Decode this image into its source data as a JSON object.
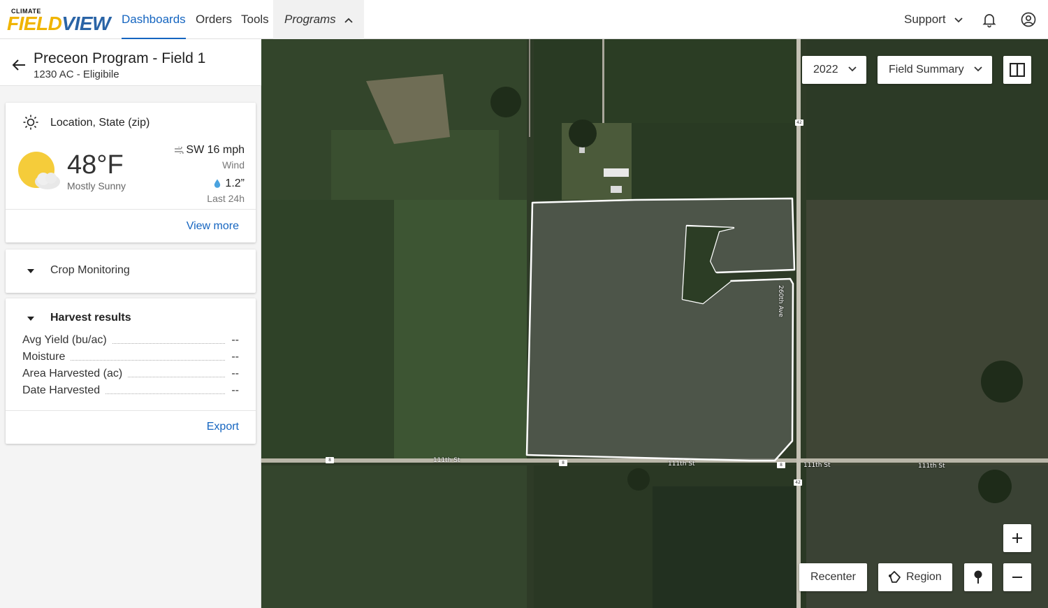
{
  "brand": {
    "small": "CLIMATE",
    "big_left": "FIELD",
    "big_right": "VIEW"
  },
  "nav": {
    "dashboards": "Dashboards",
    "orders": "Orders",
    "tools": "Tools",
    "programs": "Programs",
    "support": "Support"
  },
  "header": {
    "title": "Preceon Program - Field 1",
    "subtitle": "1230 AC - Eligibile"
  },
  "weather": {
    "location": "Location, State (zip)",
    "temperature": "48°F",
    "condition": "Mostly Sunny",
    "wind_value": "SW 16 mph",
    "wind_label": "Wind",
    "rain_value": "1.2”",
    "rain_label": "Last 24h",
    "view_more": "View more"
  },
  "crop_monitoring": {
    "label": "Crop Monitoring"
  },
  "harvest": {
    "label": "Harvest results",
    "rows": [
      {
        "label": "Avg Yield (bu/ac)",
        "value": "--"
      },
      {
        "label": "Moisture",
        "value": "--"
      },
      {
        "label": "Area Harvested (ac)",
        "value": "--"
      },
      {
        "label": "Date Harvested",
        "value": "--"
      }
    ],
    "export": "Export"
  },
  "map": {
    "year": "2022",
    "layer": "Field Summary",
    "recenter": "Recenter",
    "region": "Region",
    "roads": {
      "south": "111th St",
      "east": "260th Ave",
      "shield_a": "8",
      "shield_b": "42"
    }
  },
  "colors": {
    "accent": "#1565c0",
    "boundary": "#ffffff",
    "sun": "#f5cc3a"
  }
}
